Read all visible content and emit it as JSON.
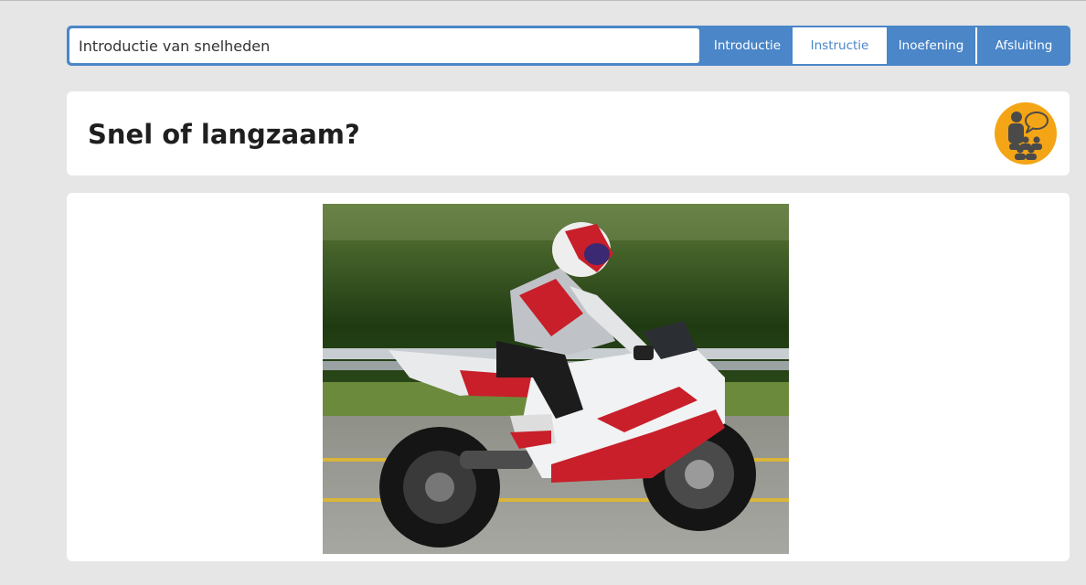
{
  "header": {
    "lesson_title": "Introductie van snelheden",
    "tabs": [
      {
        "label": "Introductie",
        "active": false
      },
      {
        "label": "Instructie",
        "active": true
      },
      {
        "label": "Inoefening",
        "active": false
      },
      {
        "label": "Afsluiting",
        "active": false
      }
    ]
  },
  "section": {
    "title": "Snel of langzaam?",
    "icon": "teacher-presenting-icon"
  },
  "media": {
    "image": "motorcycle-rider-photo"
  },
  "colors": {
    "accent": "#4a86c8",
    "badge": "#f4a516",
    "background": "#e6e6e6"
  }
}
